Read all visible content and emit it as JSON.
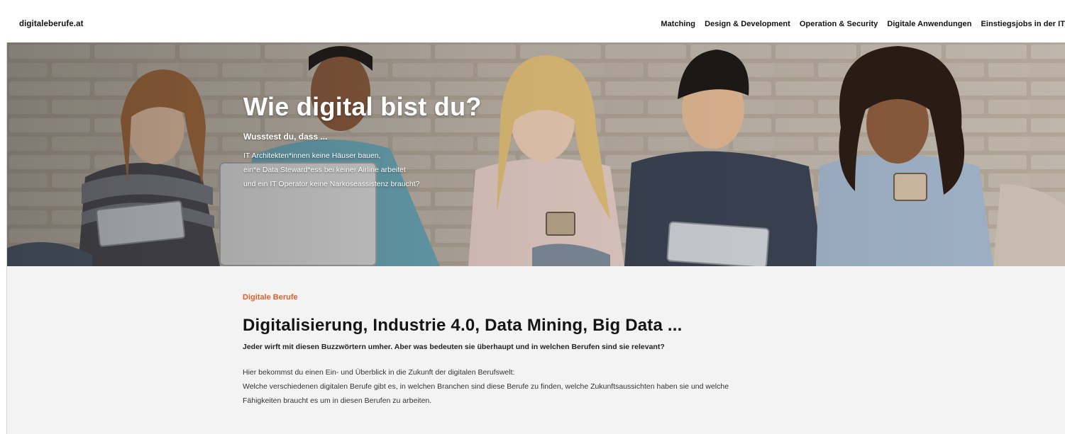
{
  "header": {
    "logo": "digitaleberufe.at",
    "nav": [
      {
        "label": "Matching"
      },
      {
        "label": "Design & Development"
      },
      {
        "label": "Operation & Security"
      },
      {
        "label": "Digitale Anwendungen"
      },
      {
        "label": "Einstiegsjobs in der IT"
      }
    ]
  },
  "hero": {
    "title": "Wie digital bist du?",
    "subtitle": "Wusstest du, dass ...",
    "lines": [
      "IT Architekten*innen keine Häuser bauen,",
      "ein*e Data Steward*ess bei keiner Airline arbeitet",
      "und ein IT Operator keine Narkoseassistenz braucht?"
    ]
  },
  "content": {
    "eyebrow": "Digitale Berufe",
    "headline": "Digitalisierung, Industrie 4.0, Data Mining, Big Data ...",
    "lead": "Jeder wirft mit diesen Buzzwörtern umher. Aber was bedeuten sie überhaupt und in welchen Berufen sind sie relevant?",
    "body": [
      "Hier bekommst du einen Ein- und Überblick in die Zukunft der digitalen Berufswelt:",
      "Welche verschiedenen digitalen Berufe gibt es, in welchen Branchen sind diese Berufe zu finden, welche Zukunftsaussichten haben sie und welche",
      "Fähigkeiten braucht es um in diesen Berufen zu arbeiten."
    ]
  },
  "colors": {
    "accent": "#e0602d",
    "content_bg": "#f3f3f3"
  }
}
